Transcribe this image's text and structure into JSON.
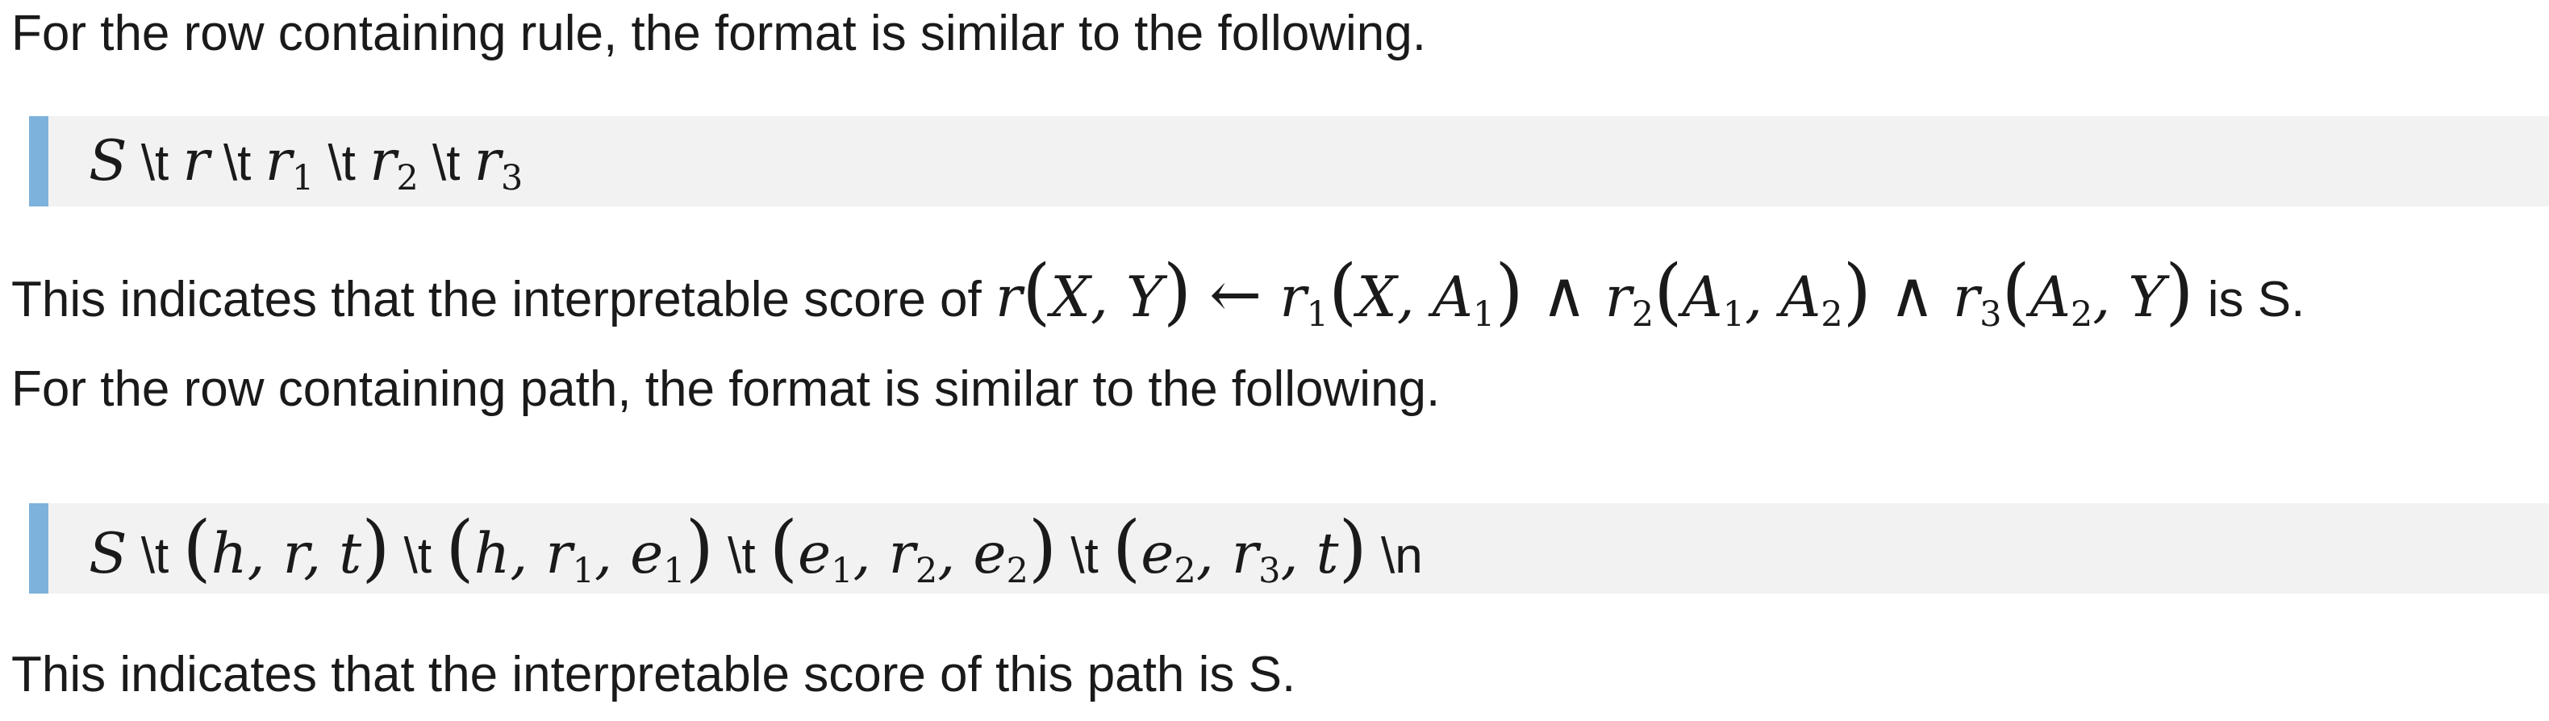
{
  "paragraphs": {
    "rule_intro": "For the row containing rule, the format is similar to the following.",
    "rule_meaning_prefix": "This indicates that the interpretable score of",
    "rule_meaning_suffix": "is S.",
    "path_intro": "For the row containing path, the format is similar to the following.",
    "path_meaning": "This indicates that the interpretable score of this path is S."
  },
  "rule_format": {
    "tab": "\\t"
  },
  "path_format": {
    "tab": "\\t",
    "newline": "\\n"
  },
  "colors": {
    "quote_bar": "#7db2dc",
    "quote_background": "#f2f2f2",
    "text": "#1a1a1a"
  }
}
